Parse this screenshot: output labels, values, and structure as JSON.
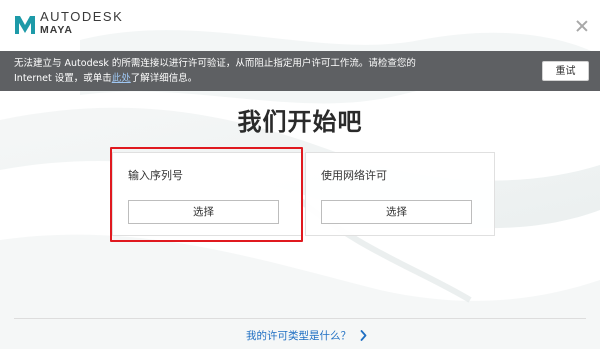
{
  "header": {
    "company": "AUTODESK",
    "product": "MAYA",
    "logo_icon": "maya-logo-icon",
    "close_icon": "close-icon"
  },
  "banner": {
    "message_line1": "无法建立与 Autodesk 的所需连接以进行许可验证，从而阻止指定用户许可工作流。请检查您的",
    "message_line2_prefix": "Internet 设置，或单击",
    "link_text": "此处",
    "message_line2_suffix": "了解详细信息。",
    "retry_label": "重试"
  },
  "main": {
    "title": "我们开始吧",
    "options": [
      {
        "label": "输入序列号",
        "button": "选择"
      },
      {
        "label": "使用网络许可",
        "button": "选择"
      }
    ]
  },
  "footer": {
    "link_text": "我的许可类型是什么？",
    "chevron_icon": "chevron-right-icon"
  },
  "colors": {
    "banner_bg": "#5e6063",
    "link": "#1f6fc3",
    "highlight_border": "#e0191f",
    "logo_teal": "#1d9aa8"
  }
}
